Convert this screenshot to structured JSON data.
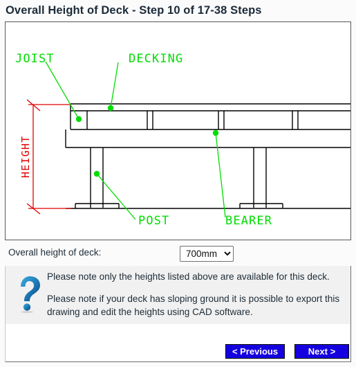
{
  "header": {
    "title": "Overall Height of Deck - Step 10 of 17-38 Steps"
  },
  "diagram": {
    "type": "deck-cross-section",
    "labels": {
      "joist": "JOIST",
      "decking": "DECKING",
      "post": "POST",
      "bearer": "BEARER",
      "height": "HEIGHT"
    },
    "colors": {
      "annotation": "#00dd00",
      "dimension": "#e00000",
      "linework": "#000000",
      "frame_border": "#595959"
    }
  },
  "form": {
    "height_label": "Overall height of deck:",
    "height_value": "700mm",
    "height_options": [
      "700mm"
    ]
  },
  "note": {
    "icon": "question-mark-icon",
    "line1": "Please note only the heights listed above are available for this deck.",
    "line2": "Please note if your deck has sloping ground it is possible to export this drawing and edit the heights using CAD software."
  },
  "footer": {
    "previous_label": "< Previous",
    "next_label": "Next >",
    "button_color": "#1500e0"
  }
}
